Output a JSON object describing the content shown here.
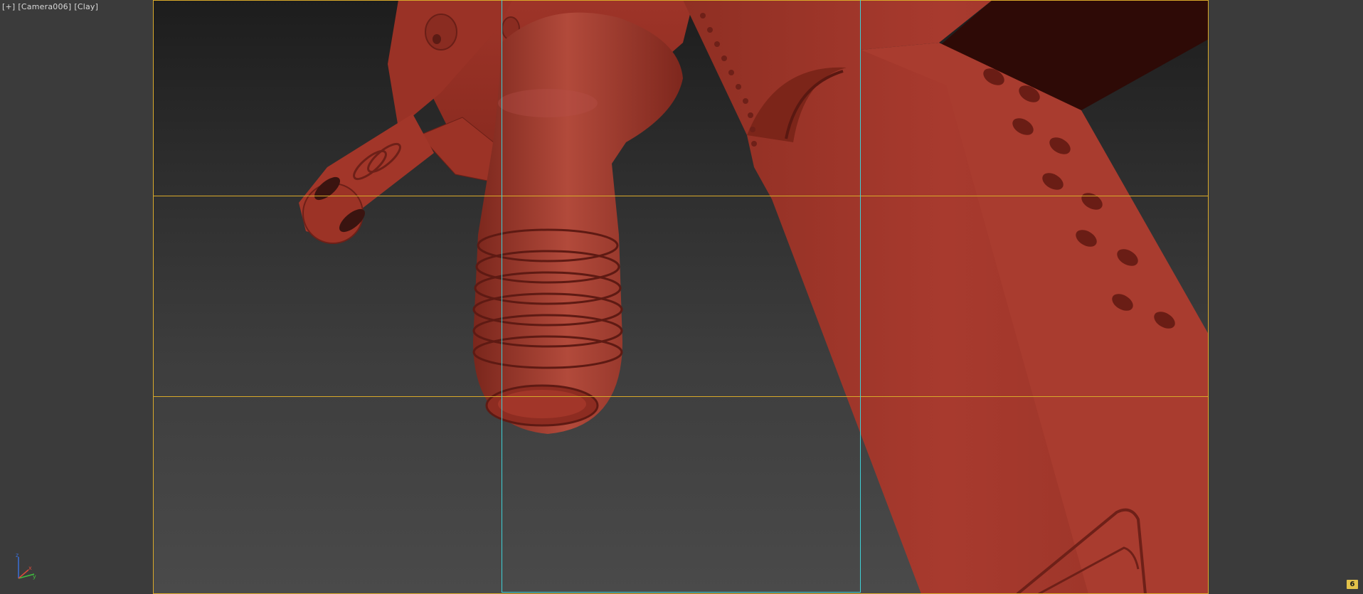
{
  "viewport": {
    "menu_label": "[+]",
    "camera_label": "[Camera006]",
    "shading_label": "[Clay]",
    "view_badge": "6"
  },
  "colors": {
    "model_base": "#a83a2e",
    "model_shadow": "#6e2018",
    "model_dark": "#2e0a06",
    "safe_frame": "#d9a92a",
    "region_frame": "#3fd0d6"
  },
  "axis_gizmo": {
    "labels": [
      "z",
      "x",
      "y"
    ]
  }
}
